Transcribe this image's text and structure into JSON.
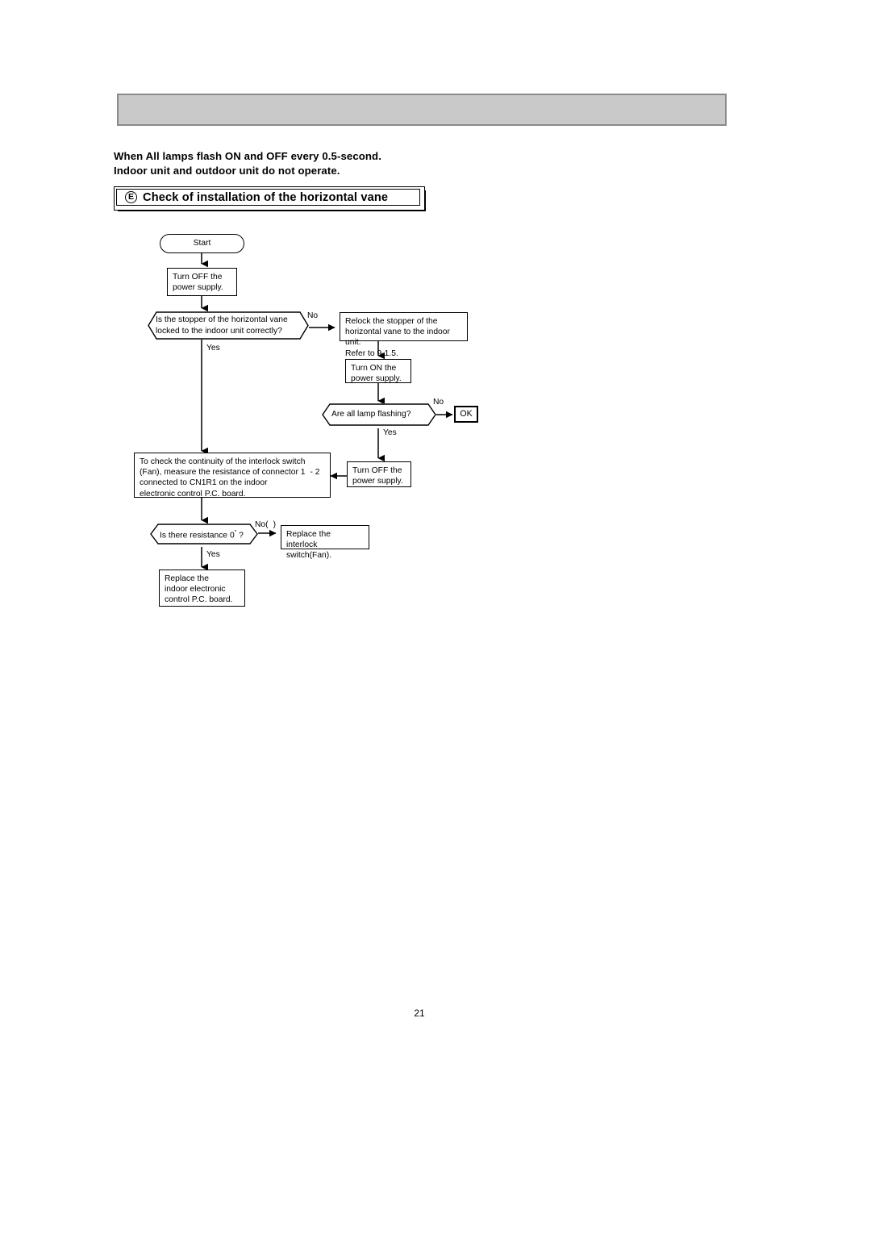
{
  "document": {
    "page_number": "21",
    "header_bar": {
      "color": "#c9c9c9",
      "border_color": "#8a8a8a"
    }
  },
  "intro": {
    "line1": "When All lamps flash ON and OFF every 0.5-second.",
    "line2": "Indoor unit and outdoor unit do not operate."
  },
  "section": {
    "marker": "E",
    "title": "Check of installation of the horizontal vane"
  },
  "flowchart": {
    "type": "flowchart",
    "nodes": {
      "start": {
        "shape": "terminator",
        "text": "Start"
      },
      "power_off_1": {
        "shape": "process",
        "line1": "Turn OFF the",
        "line2": "power supply."
      },
      "decision_stopper": {
        "shape": "decision",
        "line1": "Is the stopper of the horizontal vane",
        "line2": "locked to the indoor unit correctly?"
      },
      "relock": {
        "shape": "process",
        "line1": "Relock the stopper of the",
        "line2": "horizontal vane to the indoor unit.",
        "line3": "Refer to 9-1.5."
      },
      "power_on": {
        "shape": "process",
        "line1": "Turn ON the",
        "line2": "power supply."
      },
      "decision_lamps": {
        "shape": "decision",
        "text": "Are all lamp flashing?"
      },
      "ok": {
        "shape": "terminator-box",
        "text": "OK"
      },
      "power_off_2": {
        "shape": "process",
        "line1": "Turn OFF the",
        "line2": "power supply."
      },
      "check_continuity": {
        "shape": "process",
        "line1": "To check the continuity of the interlock switch",
        "line2_a": "(Fan), measure the resistance of connector 1",
        "line2_b": "- 2",
        "line3": "connected to CN1R1 on the indoor",
        "line4": "electronic control P.C. board."
      },
      "decision_resistance": {
        "shape": "decision",
        "text_a": "Is there resistance  0",
        "text_ohm": "\"",
        "text_b": "?"
      },
      "replace_switch": {
        "shape": "process",
        "line1": "Replace the",
        "line2": "interlock switch(Fan)."
      },
      "replace_board": {
        "shape": "process",
        "line1": "Replace the",
        "line2": "indoor electronic",
        "line3": "control P.C. board."
      }
    },
    "edge_labels": {
      "stopper_no": "No",
      "stopper_yes": "Yes",
      "lamps_no": "No",
      "lamps_yes": "Yes",
      "resistance_no_a": "No(",
      "resistance_no_b": ")",
      "resistance_yes": "Yes"
    }
  }
}
